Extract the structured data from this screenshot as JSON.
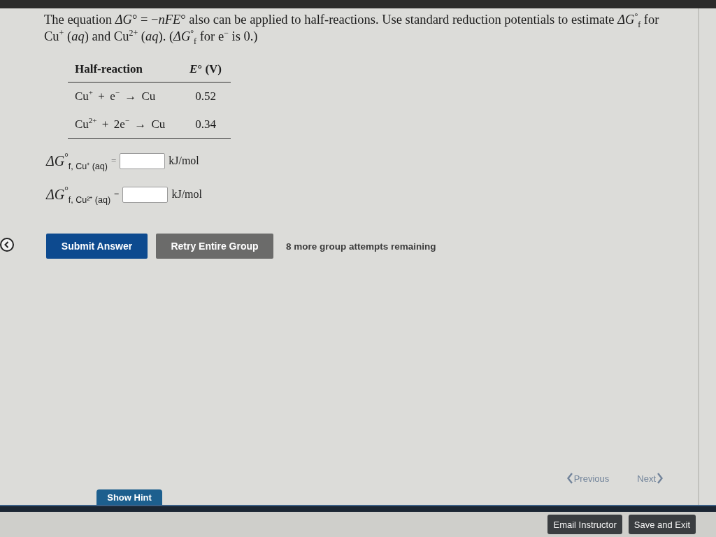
{
  "question": {
    "text": "The equation *ΔG*° = −*nFE*° also can be applied to half-reactions. Use standard reduction potentials to estimate *ΔG*$^{°}$$_{f}$ for Cu$^{+}$ (*aq*) and Cu$^{2+}$ (*aq*). (*ΔG*$^{°}$$_{f}$ for e$^{−}$ is 0.)"
  },
  "table": {
    "columns": [
      "Half-reaction",
      "*E*° (V)"
    ],
    "rows": [
      [
        "Cu$^{+}$ + e$^{−}$ → Cu",
        "0.52"
      ],
      [
        "Cu$^{2+}$ + 2e$^{−}$ → Cu",
        "0.34"
      ]
    ]
  },
  "answers": [
    {
      "label": "*ΔG*$^{°}$$_{f, Cu⁺ (aq)}$",
      "equals": "=",
      "unit": "kJ/mol"
    },
    {
      "label": "*ΔG*$^{°}$$_{f, Cu²⁺ (aq)}$",
      "equals": "=",
      "unit": "kJ/mol"
    }
  ],
  "actions": [
    {
      "label": "Submit Answer",
      "kind": "primary"
    },
    {
      "label": "Retry Entire Group",
      "kind": "secondary"
    }
  ],
  "attempts": "8 more group attempts remaining",
  "pager": [
    {
      "label": "Previous",
      "kind": "previous",
      "disabled": true
    },
    {
      "label": "Next",
      "kind": "next",
      "disabled": true
    }
  ],
  "hint_button": "Show Hint",
  "footer_buttons": [
    "Email Instructor",
    "Save and Exit"
  ]
}
